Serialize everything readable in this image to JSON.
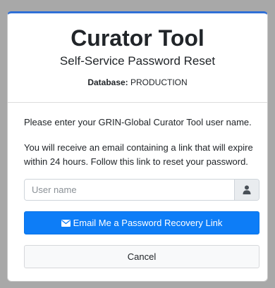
{
  "header": {
    "title": "Curator Tool",
    "subtitle": "Self-Service Password Reset",
    "database_label": "Database:",
    "database_value": "PRODUCTION"
  },
  "body": {
    "instruction_1": "Please enter your GRIN-Global Curator Tool user name.",
    "instruction_2": "You will receive an email containing a link that will expire within 24 hours. Follow this link to reset your password."
  },
  "form": {
    "username_placeholder": "User name",
    "username_value": "",
    "user_icon": "user-icon",
    "submit_icon": "envelope-icon",
    "submit_label": "Email Me a Password Recovery Link",
    "cancel_label": "Cancel"
  },
  "colors": {
    "accent": "#0d7df7",
    "top_border": "#2f6fd6",
    "background": "#a8a8a8"
  }
}
